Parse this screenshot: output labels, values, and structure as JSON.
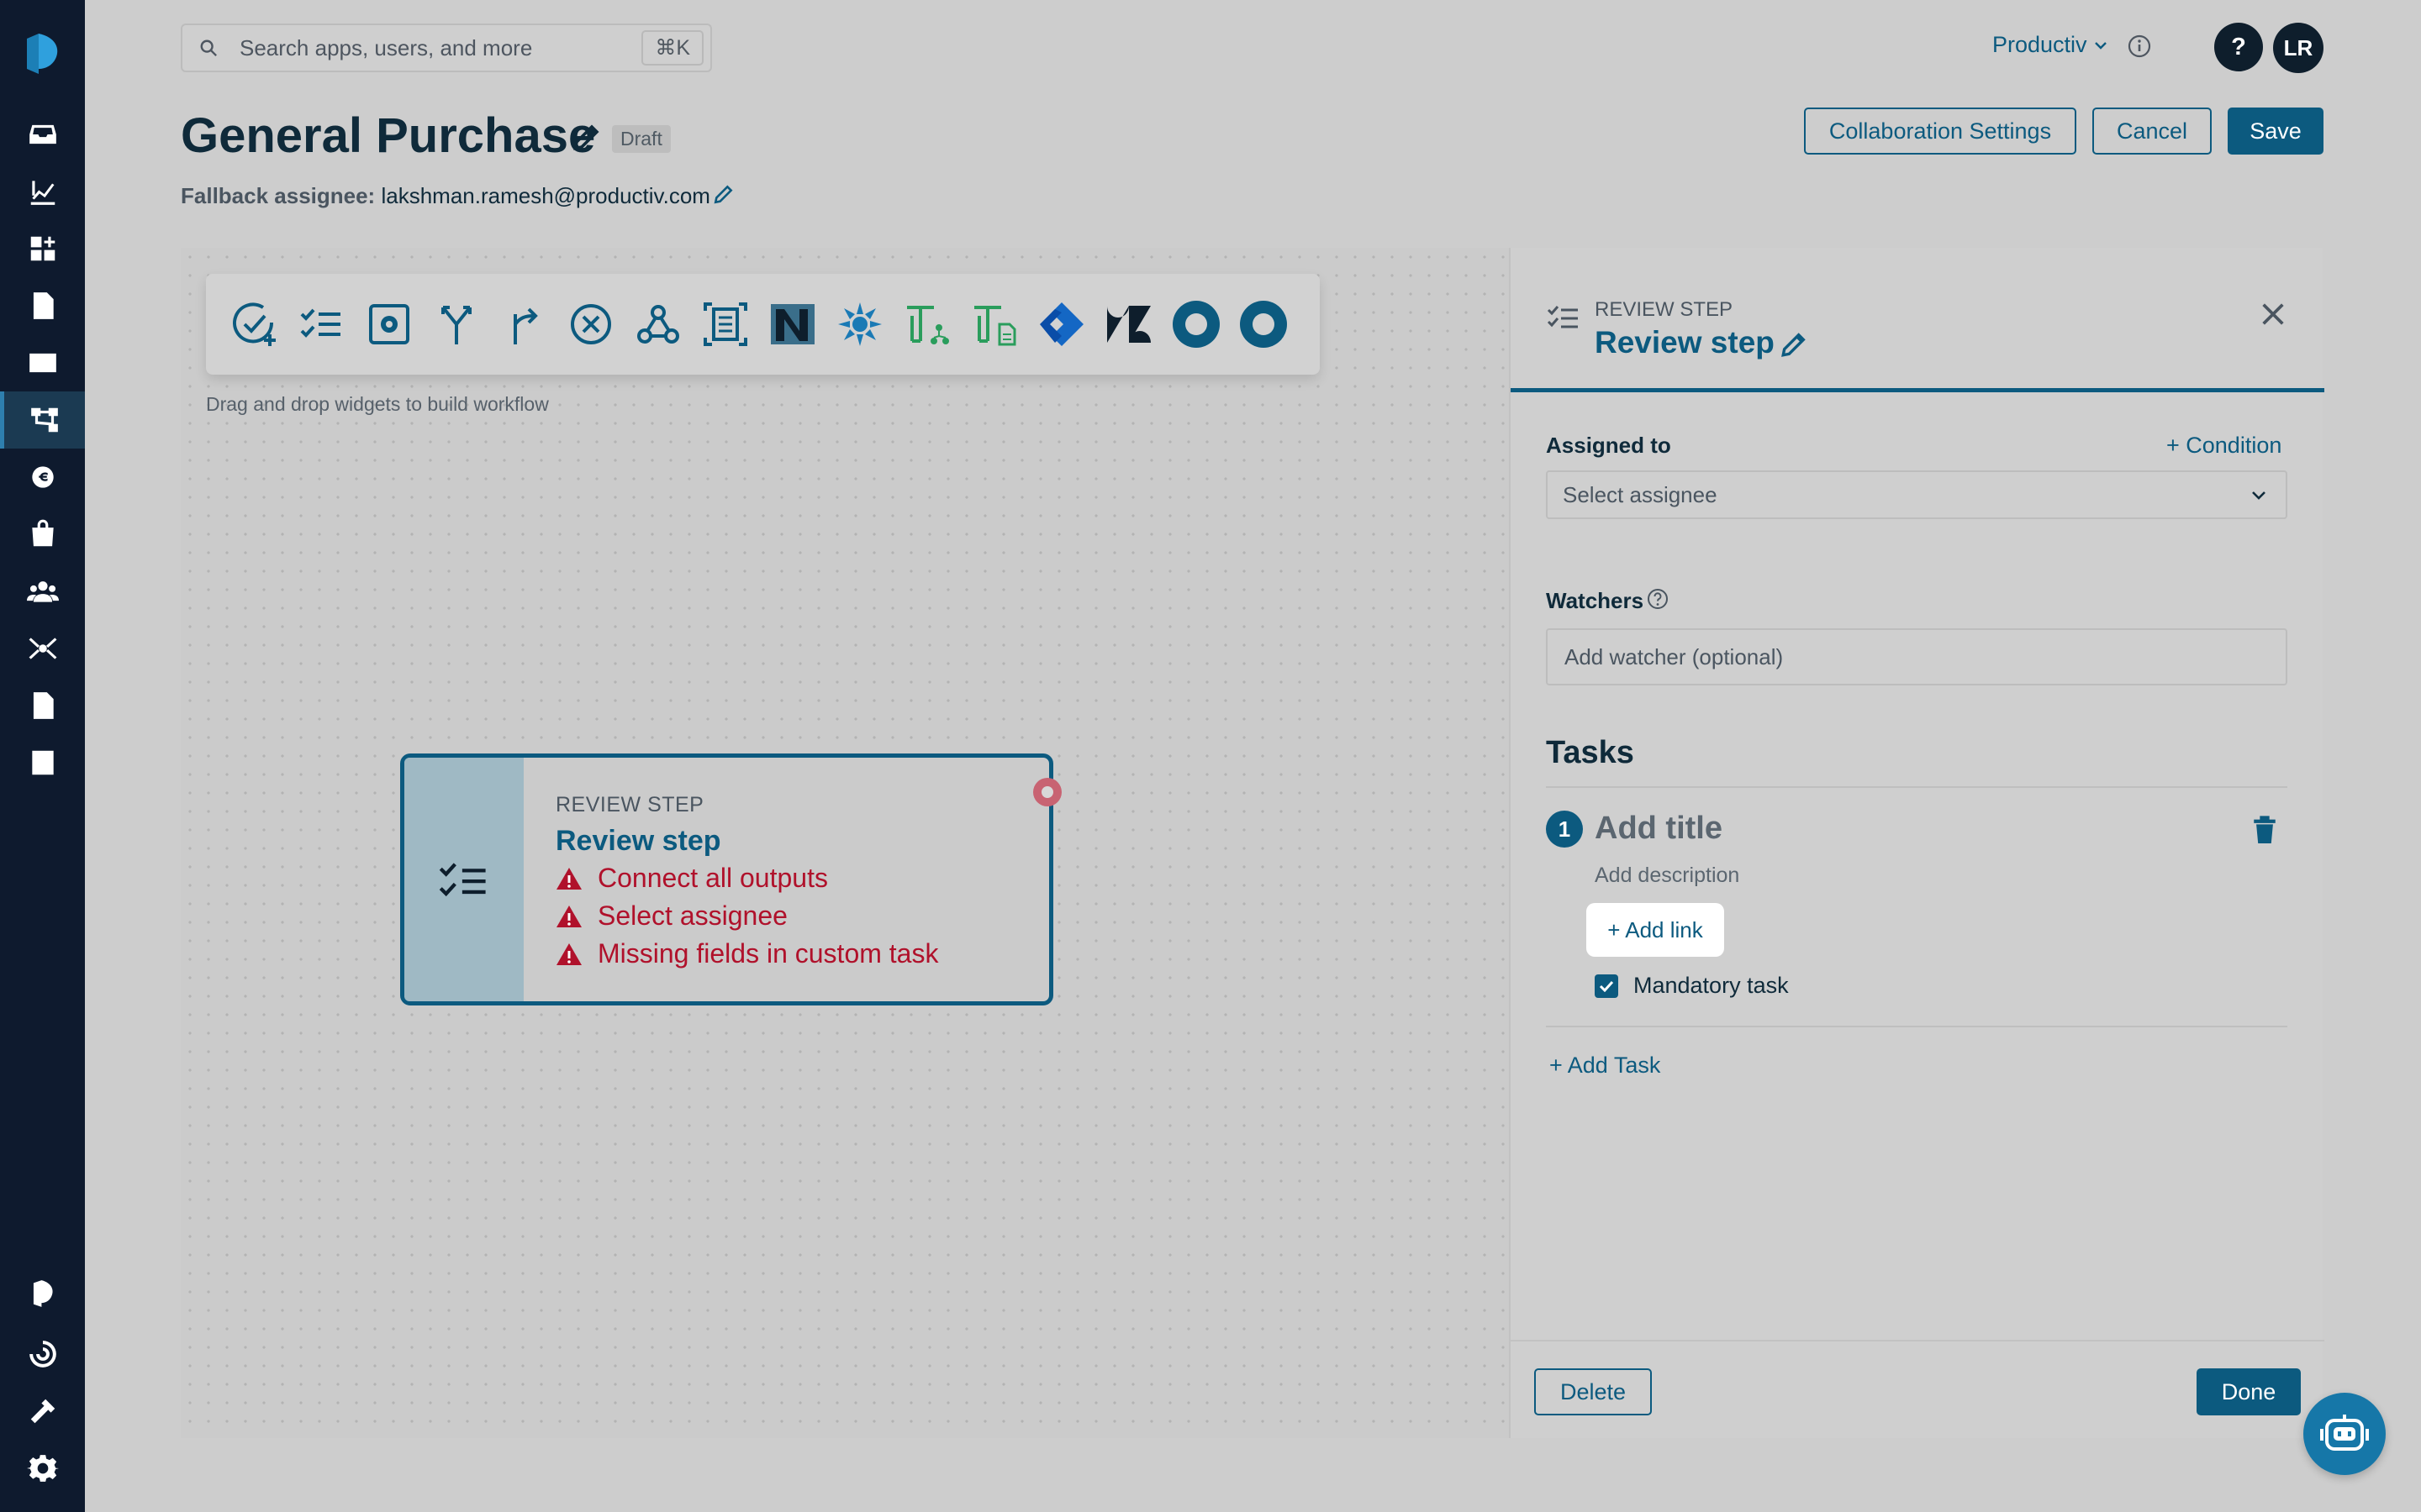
{
  "search": {
    "placeholder": "Search apps, users, and more",
    "shortcut": "⌘K"
  },
  "header": {
    "org": "Productiv",
    "help": "?",
    "avatar": "LR",
    "title": "General Purchase",
    "status": "Draft",
    "fallback_label": "Fallback assignee:",
    "fallback_value": "lakshman.ramesh@productiv.com",
    "buttons": {
      "collab": "Collaboration Settings",
      "cancel": "Cancel",
      "save": "Save"
    }
  },
  "canvas": {
    "hint": "Drag and drop widgets to build workflow",
    "node": {
      "kind": "REVIEW STEP",
      "name": "Review step",
      "errors": [
        "Connect all outputs",
        "Select assignee",
        "Missing fields in custom task"
      ]
    }
  },
  "panel": {
    "kind": "REVIEW STEP",
    "name": "Review step",
    "assigned_label": "Assigned to",
    "condition": "+ Condition",
    "assignee_placeholder": "Select assignee",
    "watchers_label": "Watchers",
    "watcher_placeholder": "Add watcher (optional)",
    "tasks_heading": "Tasks",
    "task": {
      "number": "1",
      "title": "Add title",
      "description": "Add description",
      "add_link": "+ Add link",
      "mandatory": "Mandatory task",
      "mandatory_checked": true
    },
    "add_task": "+ Add Task",
    "delete": "Delete",
    "done": "Done"
  },
  "colors": {
    "accent": "#0c5a7f",
    "error": "#b0112b",
    "sidebar": "#0e1a2e"
  }
}
